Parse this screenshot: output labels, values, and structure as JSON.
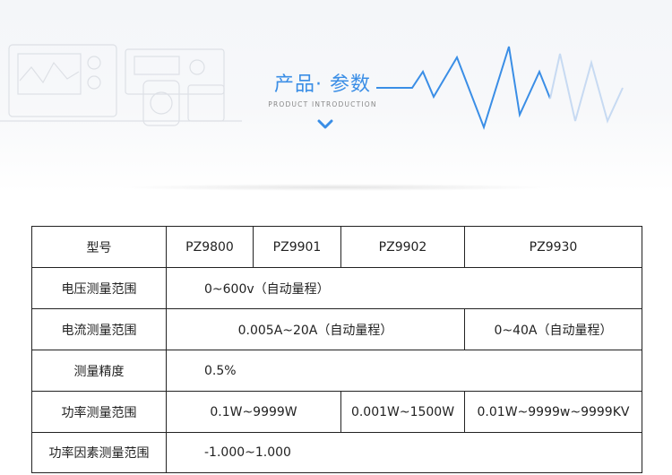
{
  "header": {
    "title": "产品· 参数",
    "subtitle": "PRODUCT INTRODUCTION"
  },
  "colors": {
    "accent": "#3a8ee6",
    "table_border": "#222222"
  },
  "icons": [
    "instrument-decoration-icon",
    "waveform-icon",
    "chevron-down-icon"
  ],
  "table": {
    "header": {
      "label": "型号",
      "models": [
        "PZ9800",
        "PZ9901",
        "PZ9902",
        "PZ9930"
      ]
    },
    "rows": [
      {
        "label": "电压测量范围",
        "cells": [
          "0~600v（自动量程）"
        ]
      },
      {
        "label": "电流测量范围",
        "cells": [
          "0.005A~20A（自动量程）",
          "0~40A（自动量程）"
        ]
      },
      {
        "label": "测量精度",
        "cells": [
          "0.5%"
        ]
      },
      {
        "label": "功率测量范围",
        "cells": [
          "0.1W~9999W",
          "0.001W~1500W",
          "0.01W~9999w~9999KV"
        ]
      },
      {
        "label": "功率因素测量范围",
        "cells": [
          "-1.000~1.000"
        ]
      }
    ]
  }
}
